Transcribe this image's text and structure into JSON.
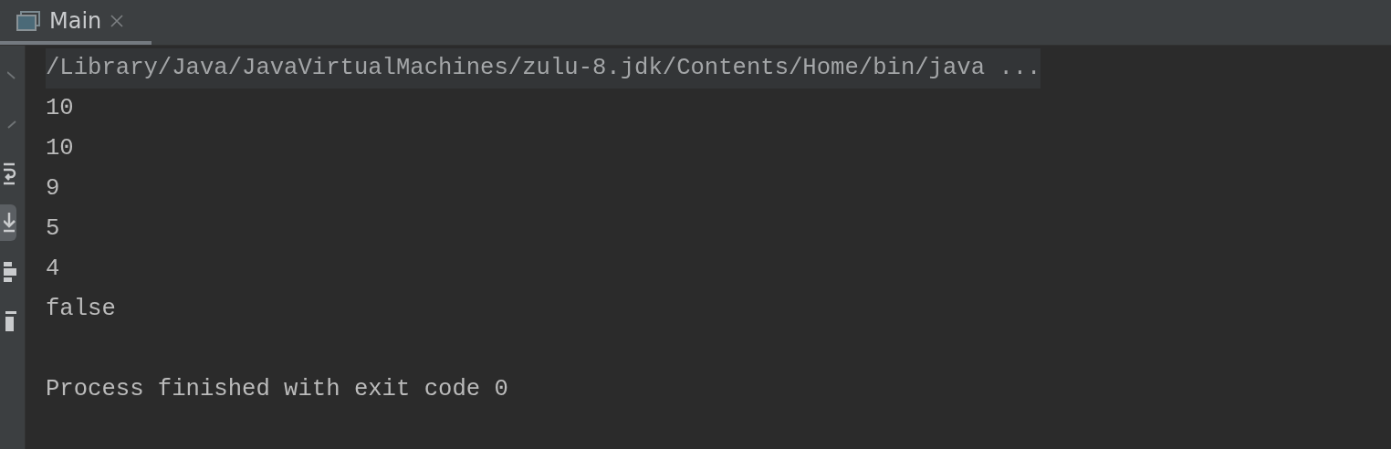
{
  "tabs": [
    {
      "label": "Main",
      "selected": true,
      "closable": true
    }
  ],
  "toolbar": [
    {
      "kind": "up",
      "selected": false
    },
    {
      "kind": "down",
      "selected": false
    },
    {
      "kind": "wrap",
      "selected": false
    },
    {
      "kind": "scroll",
      "selected": true
    },
    {
      "kind": "print",
      "selected": false
    },
    {
      "kind": "trash",
      "selected": false
    }
  ],
  "console": {
    "lines": [
      {
        "kind": "command",
        "text": "/Library/Java/JavaVirtualMachines/zulu-8.jdk/Contents/Home/bin/java ..."
      },
      {
        "kind": "output",
        "text": "10"
      },
      {
        "kind": "output",
        "text": "10"
      },
      {
        "kind": "output",
        "text": "9"
      },
      {
        "kind": "output",
        "text": "5"
      },
      {
        "kind": "output",
        "text": "4"
      },
      {
        "kind": "output",
        "text": "false"
      },
      {
        "kind": "blank"
      },
      {
        "kind": "output",
        "text": "Process finished with exit code 0"
      }
    ]
  }
}
